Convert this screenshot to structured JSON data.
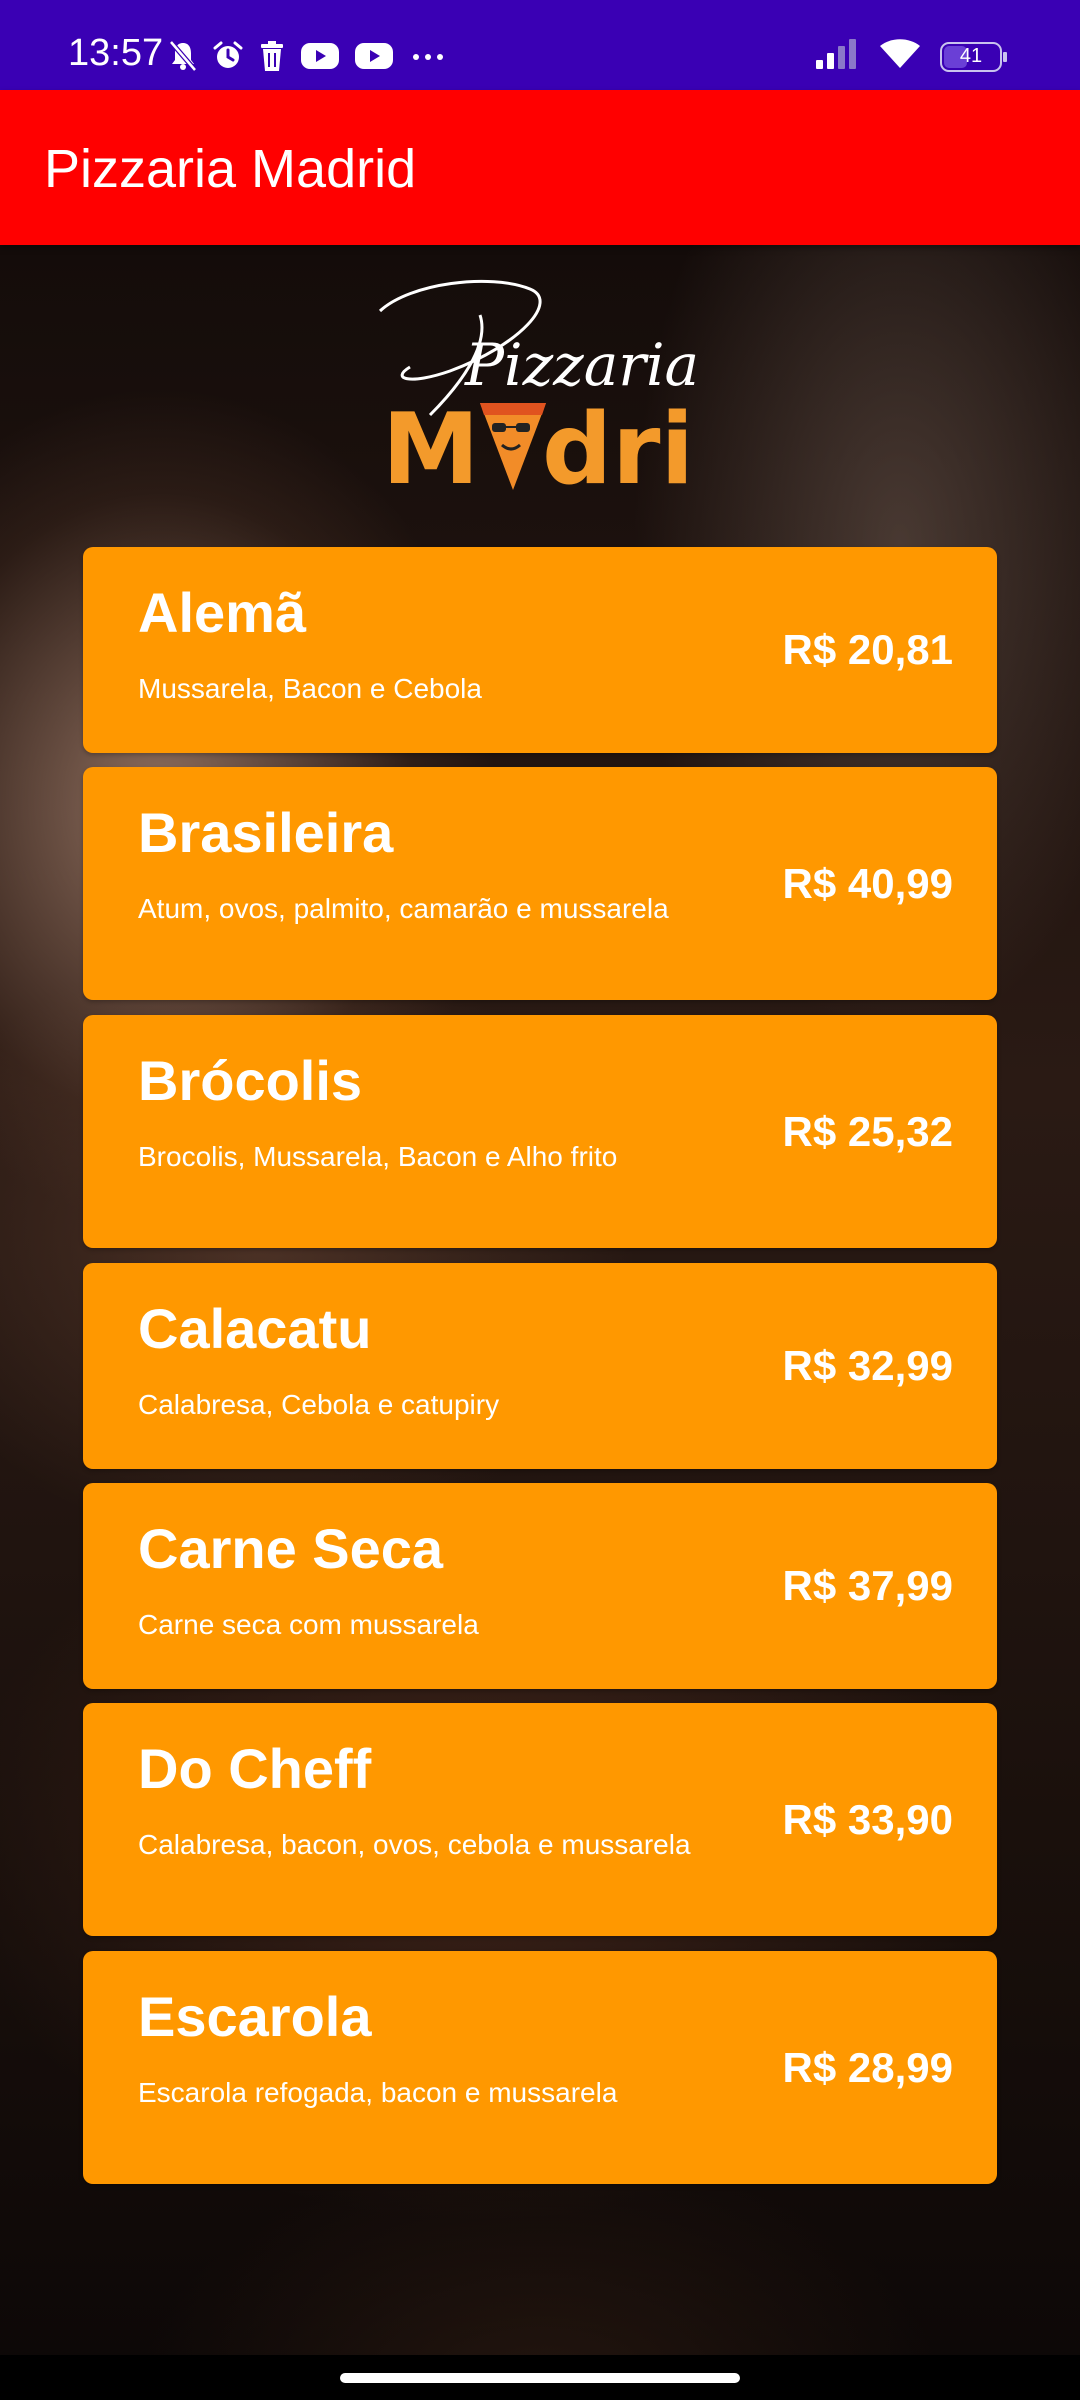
{
  "status_bar": {
    "time": "13:57",
    "battery": "41",
    "left_icons": [
      "mute-icon",
      "alarm-icon",
      "trash-icon",
      "youtube-icon",
      "youtube-icon",
      "more-dots-icon"
    ],
    "right_icons": [
      "signal-icon",
      "wifi-icon",
      "battery-icon"
    ]
  },
  "app_bar": {
    "title": "Pizzaria Madrid",
    "color": "#ff0000"
  },
  "logo": {
    "script_text": "Pizzaria",
    "brand_text": "Mdri"
  },
  "menu": {
    "card_color": "#ff9800",
    "items": [
      {
        "name": "Alemã",
        "description": "Mussarela, Bacon e Cebola",
        "price": "R$ 20,81"
      },
      {
        "name": "Brasileira",
        "description": "Atum, ovos, palmito, camarão e mussarela",
        "price": "R$ 40,99"
      },
      {
        "name": "Brócolis",
        "description": "Brocolis, Mussarela, Bacon e Alho frito",
        "price": "R$ 25,32"
      },
      {
        "name": "Calacatu",
        "description": "Calabresa, Cebola e catupiry",
        "price": "R$ 32,99"
      },
      {
        "name": "Carne Seca",
        "description": "Carne seca com mussarela",
        "price": "R$ 37,99"
      },
      {
        "name": "Do Cheff",
        "description": "Calabresa, bacon, ovos, cebola e mussarela",
        "price": "R$ 33,90"
      },
      {
        "name": "Escarola",
        "description": "Escarola refogada, bacon e mussarela",
        "price": "R$ 28,99"
      }
    ]
  }
}
